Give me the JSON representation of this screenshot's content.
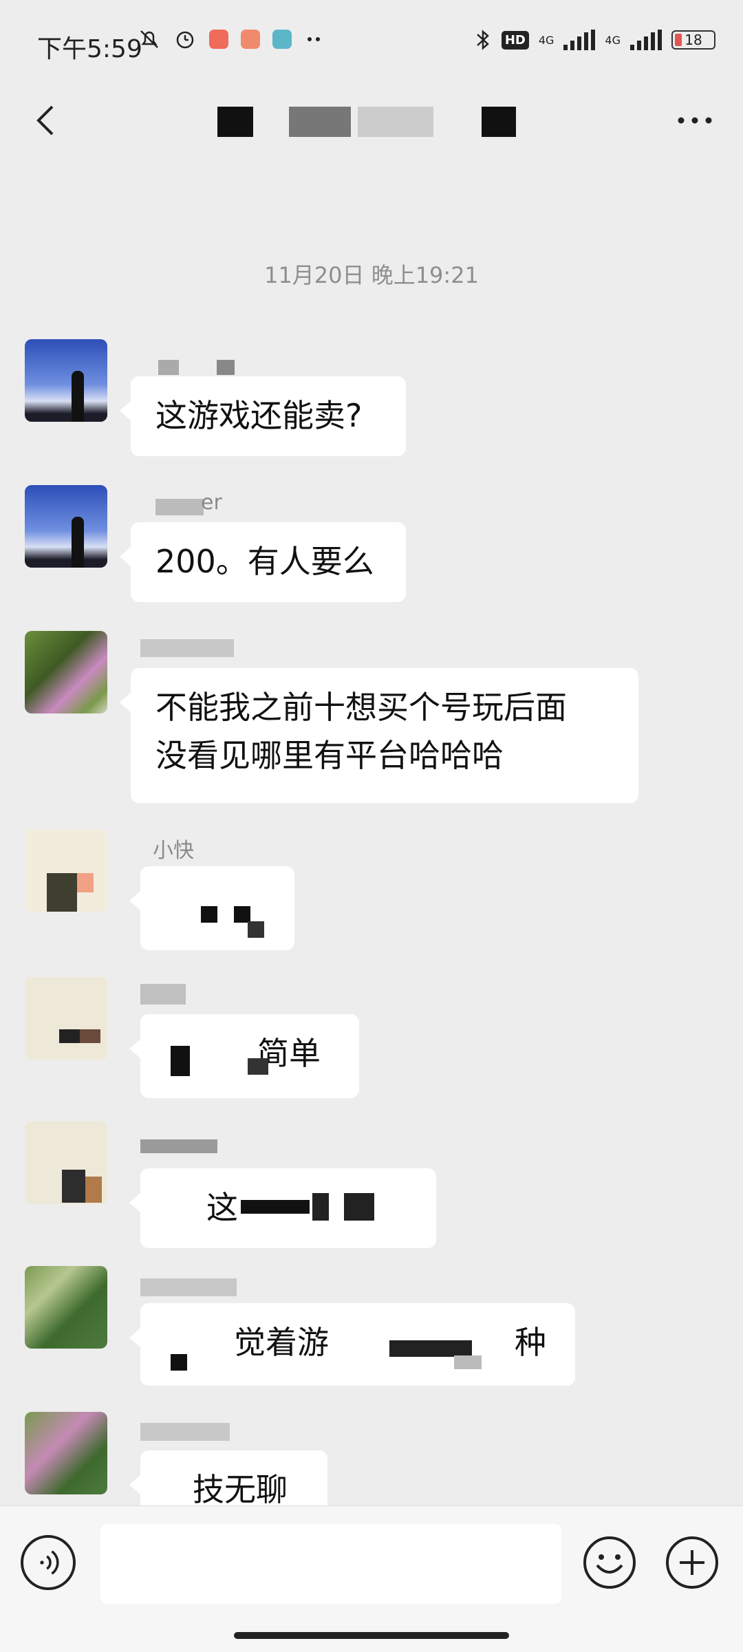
{
  "status_bar": {
    "time": "下午5:59",
    "network_label_1": "4G",
    "network_label_2": "4G",
    "hd_label": "HD",
    "battery_percent": "18",
    "battery_level": 0.18
  },
  "header": {
    "title": "",
    "back_icon": "chevron-left-icon",
    "more_icon": "more-horizontal-icon"
  },
  "timestamp": "11月20日 晚上19:21",
  "messages": [
    {
      "sender": "",
      "text": "这游戏还能卖?"
    },
    {
      "sender": "er",
      "text": "200。有人要么"
    },
    {
      "sender": "",
      "line1": "不能我之前十想买个号玩后面",
      "line2": "没看见哪里有平台哈哈哈"
    },
    {
      "sender": "小快",
      "text": ""
    },
    {
      "sender": "",
      "text": "简单"
    },
    {
      "sender": "",
      "text": "这"
    },
    {
      "sender": "",
      "text_a": "觉着游",
      "text_b": "种"
    },
    {
      "sender": "",
      "text": "技无聊"
    }
  ],
  "input": {
    "placeholder": ""
  },
  "icons": {
    "voice": "voice-icon",
    "emoji": "emoji-icon",
    "plus": "plus-icon"
  },
  "colors": {
    "background": "#ededed",
    "bubble": "#ffffff",
    "timestamp": "#8e8e8e",
    "sender": "#8a8a8a"
  }
}
